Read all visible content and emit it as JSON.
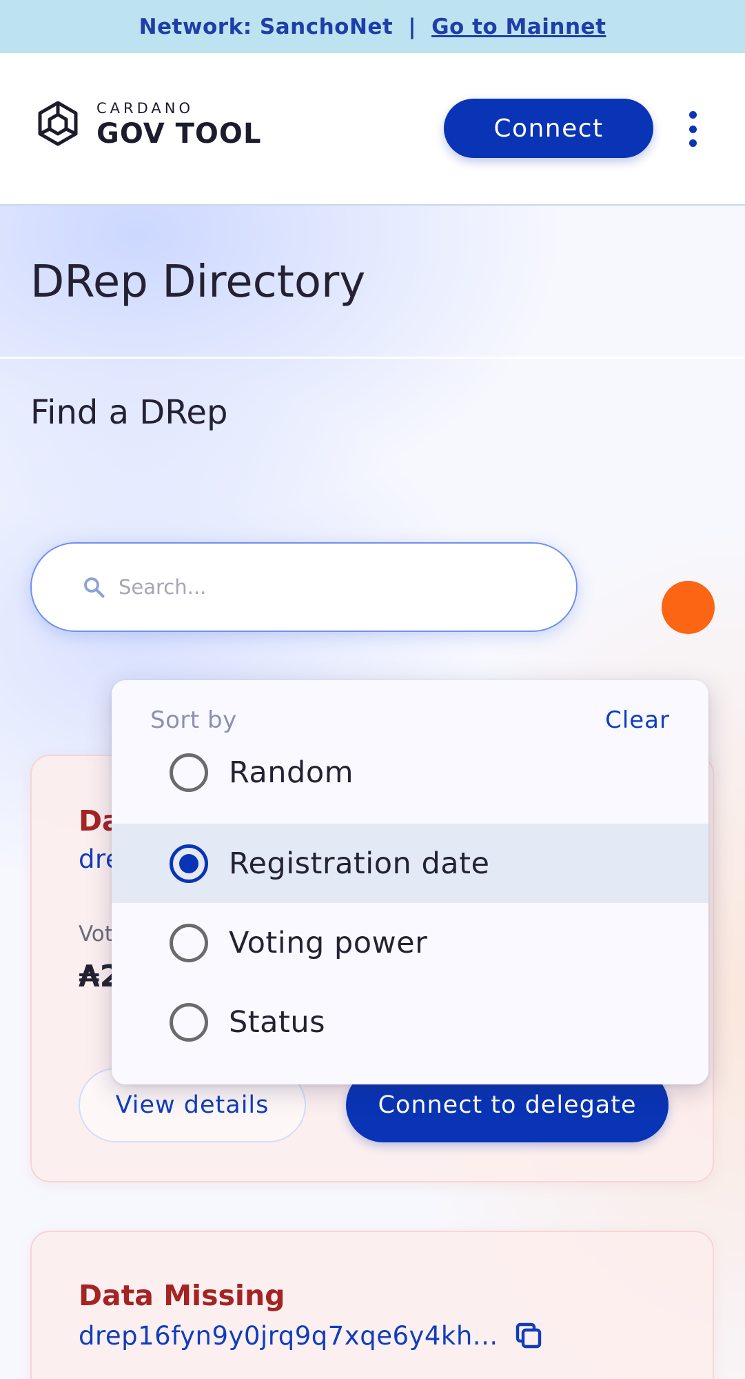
{
  "network_bar": {
    "label": "Network: SanchoNet",
    "separator": "|",
    "link": "Go to Mainnet"
  },
  "header": {
    "logo_small": "CARDANO",
    "logo_big": "GOV TOOL",
    "connect_label": "Connect",
    "menu_icon": "more-vertical-icon"
  },
  "page": {
    "title": "DRep Directory",
    "section_title": "Find a DRep"
  },
  "search": {
    "placeholder": "Search...",
    "value": ""
  },
  "sort_dropdown": {
    "header": "Sort by",
    "clear_label": "Clear",
    "options": [
      {
        "label": "Random",
        "selected": false
      },
      {
        "label": "Registration date",
        "selected": true
      },
      {
        "label": "Voting power",
        "selected": false
      },
      {
        "label": "Status",
        "selected": false
      }
    ]
  },
  "cards": [
    {
      "status": "Da",
      "id": "dre",
      "voting_power_label": "Vot",
      "voting_power_value": "₳2",
      "view_details_label": "View details",
      "delegate_label": "Connect to delegate"
    },
    {
      "status": "Data Missing",
      "id": "drep16fyn9y0jrq9q7xqe6y4kh..."
    }
  ],
  "colors": {
    "accent": "#0934b5",
    "network_bar_bg": "#bde3f0",
    "status_red": "#a42424",
    "fab_orange": "#fb6514"
  }
}
